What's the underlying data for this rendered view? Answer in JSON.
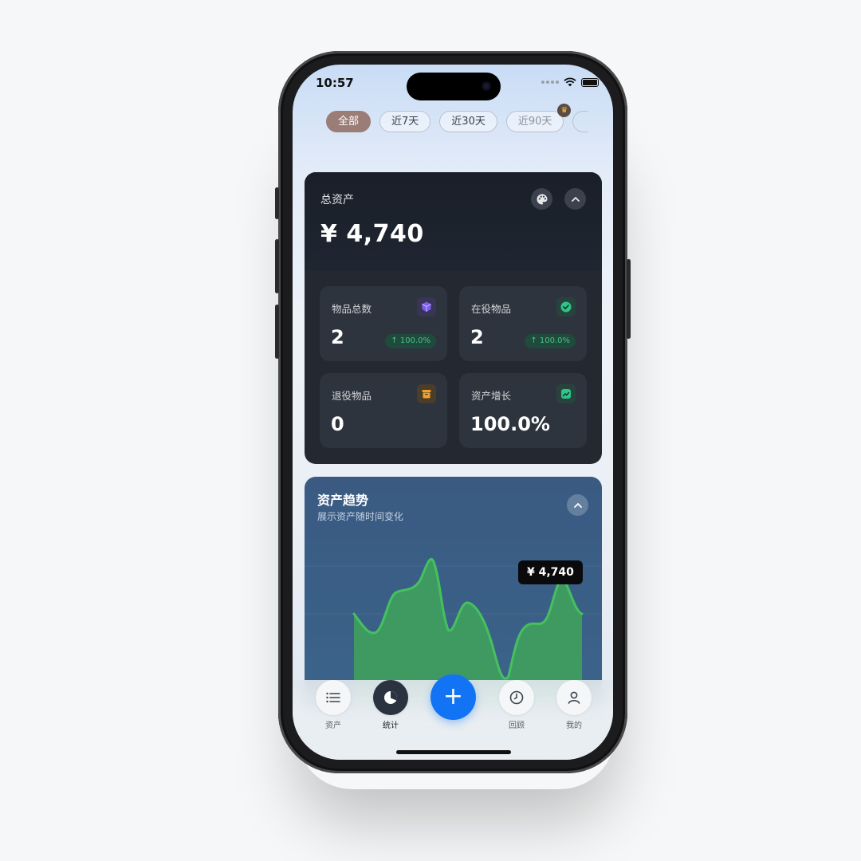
{
  "status_bar": {
    "time": "10:57"
  },
  "filters": [
    {
      "label": "全部",
      "active": true
    },
    {
      "label": "近7天",
      "active": false
    },
    {
      "label": "近30天",
      "active": false
    },
    {
      "label": "近90天",
      "active": false,
      "premium": true
    }
  ],
  "total_assets": {
    "title": "总资产",
    "value": "¥ 4,740",
    "stats": [
      {
        "label": "物品总数",
        "value": "2",
        "badge": "↑ 100.0%",
        "icon": "cube-icon",
        "icon_color": "#7b5cf0"
      },
      {
        "label": "在役物品",
        "value": "2",
        "badge": "↑ 100.0%",
        "icon": "check-circle-icon",
        "icon_color": "#2fc48a"
      },
      {
        "label": "退役物品",
        "value": "0",
        "icon": "archive-box-icon",
        "icon_color": "#f3a02c"
      },
      {
        "label": "资产增长",
        "value": "100.0%",
        "icon": "trend-up-icon",
        "icon_color": "#2fc48a"
      }
    ]
  },
  "trend": {
    "title": "资产趋势",
    "subtitle": "展示资产随时间变化",
    "tooltip": "¥ 4,740",
    "line_color": "#44c15e",
    "fill_color": "#3f9a62"
  },
  "tabbar": {
    "items": [
      {
        "label": "资产",
        "icon": "list-icon"
      },
      {
        "label": "统计",
        "icon": "pie-chart-icon",
        "active": true
      },
      {
        "label": "回顾",
        "icon": "clock-icon"
      },
      {
        "label": "我的",
        "icon": "user-icon"
      }
    ],
    "fab": "+"
  }
}
